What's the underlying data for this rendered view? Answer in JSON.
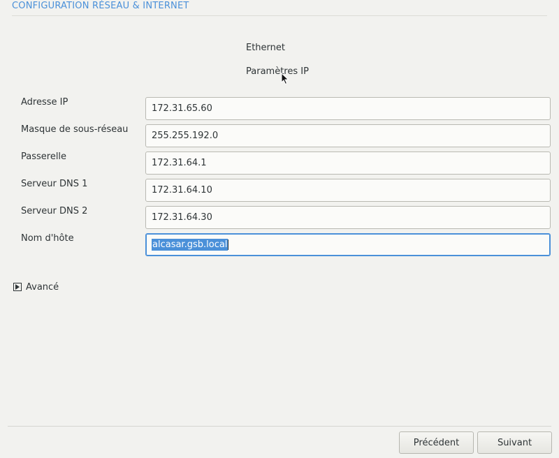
{
  "window": {
    "title": "CONFIGURATION RÉSEAU & INTERNET"
  },
  "header": {
    "interface": "Ethernet",
    "section": "Paramètres IP"
  },
  "form": {
    "fields": [
      {
        "label": "Adresse IP",
        "value": "172.31.65.60"
      },
      {
        "label": "Masque de sous-réseau",
        "value": "255.255.192.0"
      },
      {
        "label": "Passerelle",
        "value": "172.31.64.1"
      },
      {
        "label": "Serveur DNS 1",
        "value": "172.31.64.10"
      },
      {
        "label": "Serveur DNS 2",
        "value": "172.31.64.30"
      },
      {
        "label": "Nom d'hôte",
        "value": "alcasar.gsb.local",
        "focused": true,
        "selected": true
      }
    ]
  },
  "advanced": {
    "label": "Avancé",
    "expanded": false,
    "icon": "triangle-right-icon"
  },
  "footer": {
    "prev_label": "Précédent",
    "next_label": "Suivant"
  },
  "colors": {
    "accent": "#4a90d9",
    "background": "#f2f2ef",
    "text": "#2e3436"
  }
}
